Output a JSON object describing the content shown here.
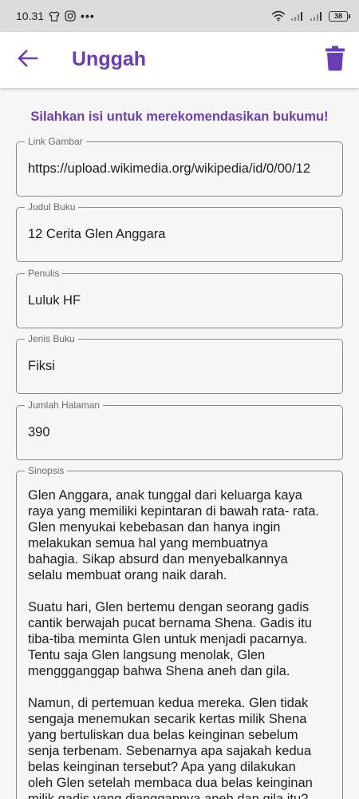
{
  "status_bar": {
    "time": "10.31",
    "battery": "38"
  },
  "app_bar": {
    "title": "Unggah",
    "back_icon": "arrow-left-icon",
    "delete_icon": "trash-icon"
  },
  "colors": {
    "accent": "#6a3fb5",
    "status_bar_bg": "#dcdcdc",
    "background": "#f6f6f6"
  },
  "form": {
    "subtitle": "Silahkan isi untuk merekomendasikan bukumu!",
    "link_gambar": {
      "label": "Link Gambar",
      "value": "https://upload.wikimedia.org/wikipedia/id/0/00/12"
    },
    "judul_buku": {
      "label": "Judul Buku",
      "value": "12 Cerita Glen Anggara"
    },
    "penulis": {
      "label": "Penulis",
      "value": "Luluk HF"
    },
    "jenis_buku": {
      "label": "Jenis Buku",
      "value": "Fiksi"
    },
    "jumlah_halaman": {
      "label": "Jumlah Halaman",
      "value": "390"
    },
    "sinopsis": {
      "label": "Sinopsis",
      "value": "Glen Anggara, anak tunggal dari keluarga kaya raya yang memiliki kepintaran di bawah rata- rata. Glen menyukai kebebasan dan hanya ingin melakukan semua hal yang membuatnya bahagia. Sikap absurd dan menyebalkannya selalu membuat orang naik darah.\n\nSuatu hari, Glen bertemu dengan seorang gadis cantik berwajah pucat bernama Shena. Gadis itu tiba-tiba meminta Glen untuk menjadi pacarnya. Tentu saja Glen langsung menolak, Glen menggganggap bahwa Shena aneh dan gila.\n\nNamun, di pertemuan kedua mereka. Glen tidak sengaja menemukan secarik kertas milik Shena yang bertuliskan dua belas keinginan sebelum senja terbenam. Sebenarnya apa sajakah kedua belas keinginan tersebut? Apa yang dilakukan oleh Glen setelah membaca dua belas keinginan milik gadis yang dianggapnya aneh dan gila itu?"
    }
  }
}
